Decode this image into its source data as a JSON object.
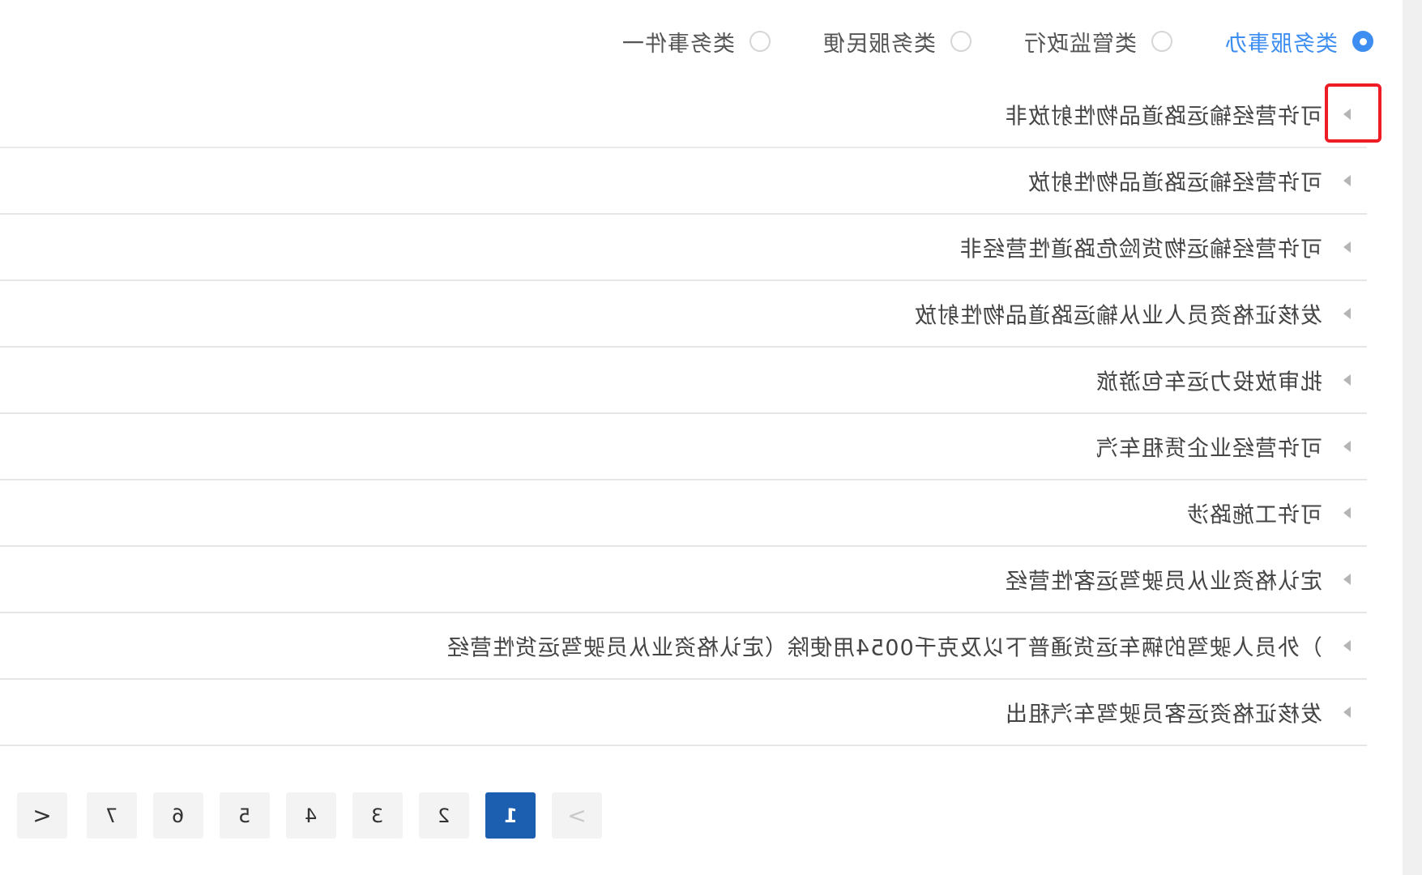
{
  "filters": {
    "options": [
      {
        "label": "类务服事办",
        "checked": true
      },
      {
        "label": "类管监政行",
        "checked": false
      },
      {
        "label": "类务服民便",
        "checked": false
      },
      {
        "label": "类务事件一",
        "checked": false
      }
    ]
  },
  "list": {
    "items": [
      "可许营经输运路道品物性射放非",
      "可许营经输运路道品物性射放",
      "可许营经输运物货险危路道性营经非",
      "发核证格资员人业从输运路道品物性射放",
      "批审放投力运车包游旅",
      "可许营经业企赁租车汽",
      "可许工施路涉",
      "定认格资业从员驶驾运客性营经",
      "）外员人驶驾的辆车运货通普下以及克千0054用使除（定认格资业从员驶驾运货性营经",
      "发核证格资运客员驶驾车汽租出"
    ]
  },
  "pagination": {
    "prev": "<",
    "next": ">",
    "pages": [
      "1",
      "2",
      "3",
      "4",
      "5",
      "6",
      "7"
    ],
    "current": "1"
  }
}
